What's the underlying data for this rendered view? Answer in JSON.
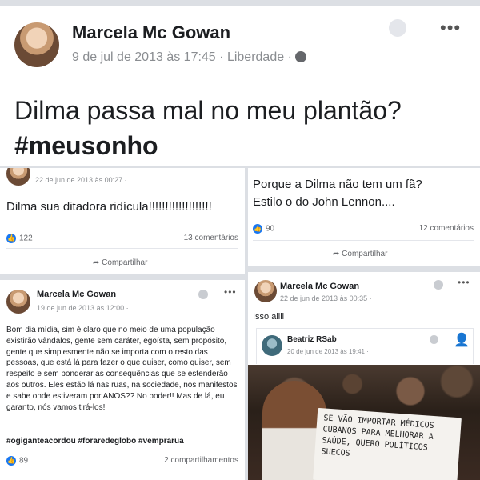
{
  "top_post": {
    "author": "Marcela Mc Gowan",
    "date": "9 de jul de 2013 às 17:45",
    "separator": "·",
    "location": "Liberdade",
    "text_line1": "Dilma passa mal no meu plantão?",
    "text_line2": "#meusonho"
  },
  "post_left_1": {
    "date": "22 de jun de 2013 às 00:27 ·",
    "text": "Dilma sua ditadora ridícula!!!!!!!!!!!!!!!!!!!",
    "likes": "122",
    "comments": "13 comentários",
    "share": "Compartilhar"
  },
  "post_right_1": {
    "text_line1": "Porque a Dilma não tem um fã?",
    "text_line2": "Estilo o do John Lennon....",
    "likes": "90",
    "comments": "12 comentários",
    "share": "Compartilhar"
  },
  "post_left_2": {
    "author": "Marcela Mc Gowan",
    "date": "19 de jun de 2013 às 12:00 ·",
    "body": "Bom dia mídia, sim é claro que no meio de uma população existirão vândalos, gente sem caráter, egoísta, sem propósito, gente que simplesmente não se importa com o resto das pessoas, que está lá para fazer o que quiser, como quiser, sem respeito e sem ponderar as consequências que se estenderão aos outros. Eles estão lá nas ruas, na sociedade, nos manifestos e sabe onde estiveram por ANOS?? No poder!! Mas de lá, eu garanto, nós vamos tirá-los!",
    "hashtags": "#ogiganteacordou #foraredeglobo #vemprarua",
    "likes": "89",
    "shares": "2 compartilhamentos"
  },
  "post_right_2": {
    "author": "Marcela Mc Gowan",
    "date": "22 de jun de 2013 às 00:35 ·",
    "text": "Isso aiiii",
    "shared_author": "Beatriz RSab",
    "shared_date": "20 de jun de 2013 às 19:41 ·",
    "sign_text": "SE VÃO IMPORTAR MÉDICOS CUBANOS PARA MELHORAR A SAÚDE, QUERO POLÍTICOS SUECOS"
  },
  "colors": {
    "facebook_blue": "#1877f2",
    "grey_text": "#8a8d91"
  }
}
